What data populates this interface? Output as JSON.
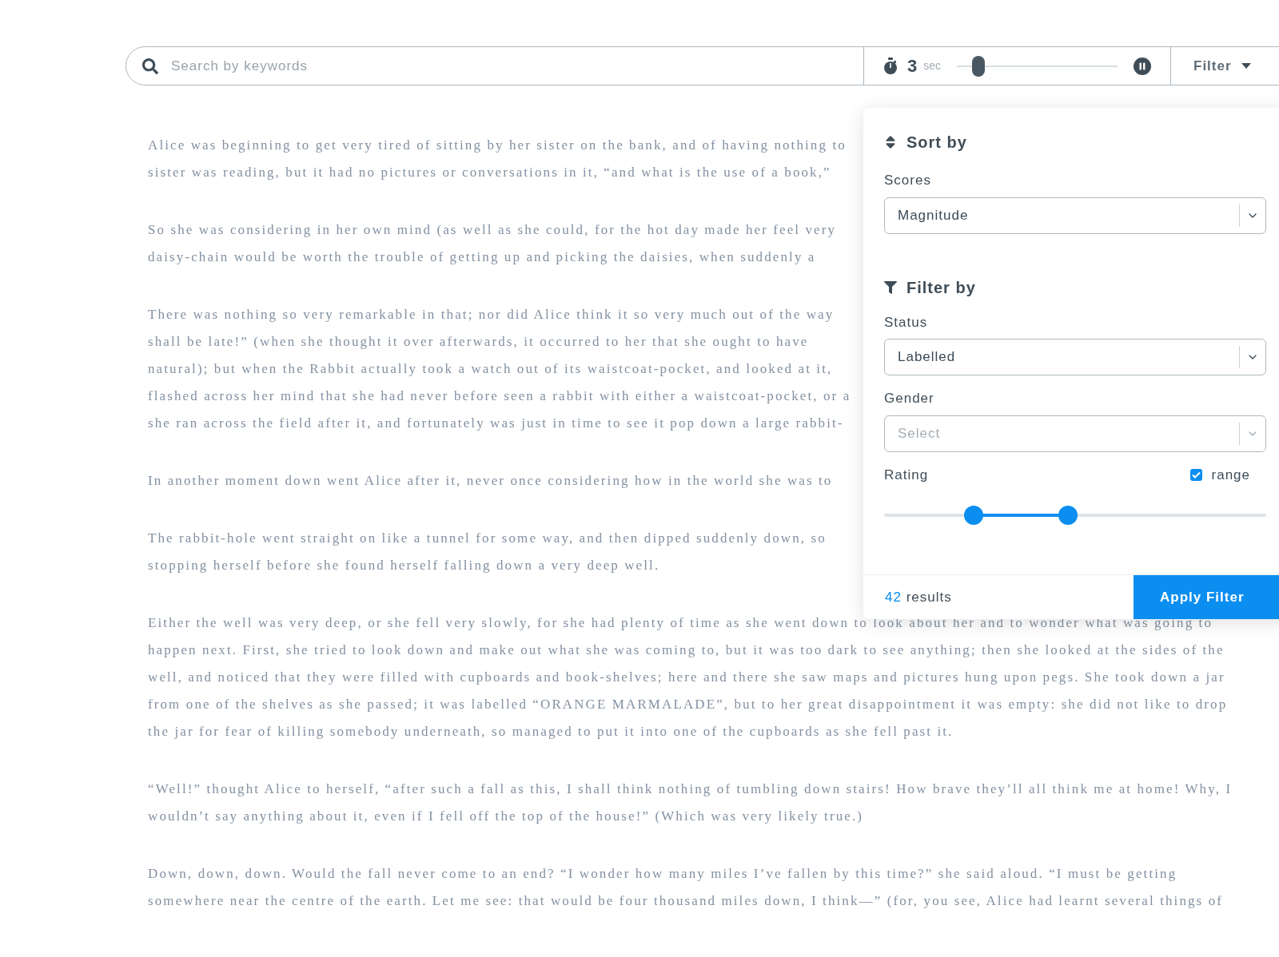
{
  "search": {
    "placeholder": "Search by keywords"
  },
  "timer": {
    "value": "3",
    "unit": "sec",
    "level": 0.1
  },
  "filter_button": {
    "label": "Filter"
  },
  "article": {
    "paragraphs": [
      {
        "lines": [
          "Alice was beginning to get very tired of sitting by her sister on the bank, and of having nothing to",
          "sister was reading, but it had no pictures or conversations in it, “and what is the use of a book,”"
        ]
      },
      {
        "lines": [
          "So she was considering in her own mind (as well as she could, for the hot day made her feel very",
          "daisy-chain would be worth the trouble of getting up and picking the daisies, when suddenly a"
        ]
      },
      {
        "lines": [
          "There was nothing so very remarkable in that; nor did Alice think it so very much out of the way",
          "shall be late!” (when she thought it over afterwards, it occurred to her that she ought to have",
          "natural); but when the Rabbit actually took a watch out of its waistcoat-pocket, and looked at it,",
          "flashed across her mind that she had never before seen a rabbit with either a waistcoat-pocket, or a",
          "she ran across the field after it, and fortunately was just in time to see it pop down a large rabbit-"
        ]
      },
      {
        "lines": [
          "In another moment down went Alice after it, never once considering how in the world she was to"
        ]
      },
      {
        "lines": [
          "The rabbit-hole went straight on like a tunnel for some way, and then dipped suddenly down, so",
          "stopping herself before she found herself falling down a very deep well."
        ]
      },
      {
        "lines": [
          "Either the well was very deep, or she fell very slowly, for she had plenty of time as she went down to look about her and to wonder what was going to",
          "happen next. First, she tried to look down and make out what she was coming to, but it was too dark to see anything; then she looked at the sides of the",
          "well, and noticed that they were filled with cupboards and book-shelves; here and there she saw maps and pictures hung upon pegs. She took down a jar",
          "from one of the shelves as she passed; it was labelled “ORANGE MARMALADE”, but to her great disappointment it was empty: she did not like to drop",
          "the jar for fear of killing somebody underneath, so managed to put it into one of the cupboards as she fell past it."
        ]
      },
      {
        "lines": [
          "“Well!” thought Alice to herself, “after such a fall as this, I shall think nothing of tumbling down stairs! How brave they’ll all think me at home! Why, I",
          "wouldn’t say anything about it, even if I fell off the top of the house!” (Which was very likely true.)"
        ]
      },
      {
        "lines": [
          "Down, down, down. Would the fall never come to an end? “I wonder how many miles I’ve fallen by this time?” she said aloud. “I must be getting",
          "somewhere near the centre of the earth. Let me see: that would be four thousand miles down, I think—” (for, you see, Alice had learnt several things of"
        ]
      }
    ]
  },
  "panel": {
    "sort_section": {
      "title": "Sort by",
      "fields": [
        {
          "label": "Scores",
          "value": "Magnitude"
        }
      ]
    },
    "filter_section": {
      "title": "Filter by",
      "fields": [
        {
          "label": "Status",
          "value": "Labelled"
        },
        {
          "label": "Gender",
          "placeholder": "Select"
        }
      ],
      "rating": {
        "label": "Rating",
        "range_checkbox": {
          "label": "range",
          "checked": true
        },
        "range_start": {
          "level": 0.22
        },
        "range_end": {
          "level": 0.48
        }
      }
    },
    "footer": {
      "count": "42",
      "count_label": "results",
      "apply_button": "Apply Filter"
    }
  }
}
